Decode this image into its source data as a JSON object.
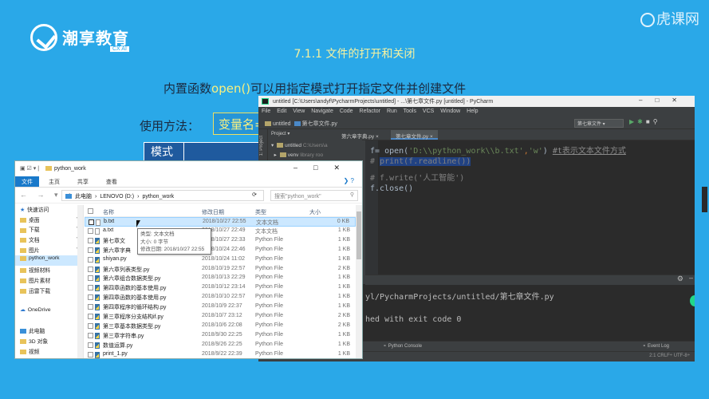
{
  "slide": {
    "logo_name": "潮享教育",
    "logo_sub": "CX AI",
    "watermark": "虎课网",
    "title": "7.1.1 文件的打开和关闭",
    "line_prefix": "内置函数",
    "line_highlight": "open()",
    "line_suffix": "可以用指定模式打开指定文件并创建文件",
    "usage_label": "使用方法：",
    "usage_box": "变量名=",
    "table_header": "模式"
  },
  "pycharm": {
    "title": "untitled [C:\\Users\\andyf\\PycharmProjects\\untitled] - ...\\第七章文件.py [untitled] - PyCharm",
    "menu": [
      "File",
      "Edit",
      "View",
      "Navigate",
      "Code",
      "Refactor",
      "Run",
      "Tools",
      "VCS",
      "Window",
      "Help"
    ],
    "breadcrumb_project": "untitled",
    "breadcrumb_file": "第七章文件.py",
    "run_config": "第七章文件",
    "project_header": "Project",
    "strip_label": "1: Project",
    "tabs": [
      "第六章字典.py",
      "第七章文件.py"
    ],
    "tree": {
      "root": "untitled",
      "root_path": "C:\\Users\\a",
      "venv": "venv",
      "venv_note": "library roo"
    },
    "code": {
      "l1_var": "f",
      "l1_eq": "= open(",
      "l1_str": "'D:\\\\python_work\\\\b.txt'",
      "l1_comma": ",",
      "l1_mode": "'w'",
      "l1_close": ")",
      "l1_comment": "#t表示文本文件方式",
      "l2_hash": "# ",
      "l2_sel": "print(f.readline())",
      "l3": "# f.write('人工智能')",
      "l4": "f.close()"
    },
    "run": {
      "l1": "yl/PycharmProjects/untitled/第七章文件.py",
      "l2": "hed with exit code 0"
    },
    "bottom_tabs": [
      "Python Console"
    ],
    "event_log": "Event Log",
    "status": "2:1  CRLF÷  UTF-8÷"
  },
  "explorer": {
    "title": "python_work",
    "ribbon": {
      "file": "文件",
      "home": "主页",
      "share": "共享",
      "view": "查看"
    },
    "address": [
      "此电脑",
      "LENOVO (D:)",
      "python_work"
    ],
    "search_placeholder": "搜索\"python_work\"",
    "nav_items": [
      {
        "label": "快速访问",
        "icon": "star"
      },
      {
        "label": "桌面",
        "icon": "folder",
        "pin": true
      },
      {
        "label": "下载",
        "icon": "folder",
        "pin": true
      },
      {
        "label": "文档",
        "icon": "folder",
        "pin": true
      },
      {
        "label": "图片",
        "icon": "folder",
        "pin": true
      },
      {
        "label": "python_work",
        "icon": "folder",
        "selected": true
      },
      {
        "label": "视频材料",
        "icon": "folder"
      },
      {
        "label": "图片素材",
        "icon": "folder"
      },
      {
        "label": "迅雷下载",
        "icon": "folder"
      },
      {
        "label": "",
        "icon": "none"
      },
      {
        "label": "OneDrive",
        "icon": "cloud"
      },
      {
        "label": "",
        "icon": "none"
      },
      {
        "label": "此电脑",
        "icon": "pc"
      },
      {
        "label": "3D 对象",
        "icon": "folder"
      },
      {
        "label": "视频",
        "icon": "folder"
      }
    ],
    "columns": {
      "name": "名称",
      "date": "修改日期",
      "type": "类型",
      "size": "大小"
    },
    "files": [
      {
        "name": "b.txt",
        "date": "2018/10/27 22:55",
        "type": "文本文档",
        "size": "0 KB",
        "selected": true,
        "kind": "txt"
      },
      {
        "name": "a.txt",
        "date": "2018/10/27 22:49",
        "type": "文本文档",
        "size": "1 KB",
        "kind": "txt"
      },
      {
        "name": "第七章文",
        "date": "2018/10/27 22:33",
        "type": "Python File",
        "size": "1 KB",
        "kind": "py"
      },
      {
        "name": "第六章字典",
        "date": "2018/10/24 22:46",
        "type": "Python File",
        "size": "1 KB",
        "kind": "py"
      },
      {
        "name": "shiyan.py",
        "date": "2018/10/24 11:02",
        "type": "Python File",
        "size": "1 KB",
        "kind": "py"
      },
      {
        "name": "第六章列表类型.py",
        "date": "2018/10/19 22:57",
        "type": "Python File",
        "size": "2 KB",
        "kind": "py"
      },
      {
        "name": "第六章组合数据类型.py",
        "date": "2018/10/13 22:29",
        "type": "Python File",
        "size": "1 KB",
        "kind": "py"
      },
      {
        "name": "第四章函数的基本使用.py",
        "date": "2018/10/12 23:14",
        "type": "Python File",
        "size": "1 KB",
        "kind": "py"
      },
      {
        "name": "第四章函数的基本使用.py",
        "date": "2018/10/10 22:57",
        "type": "Python File",
        "size": "1 KB",
        "kind": "py"
      },
      {
        "name": "第四章程序的循环结构.py",
        "date": "2018/10/9 22:37",
        "type": "Python File",
        "size": "1 KB",
        "kind": "py"
      },
      {
        "name": "第三章程序分支结构if.py",
        "date": "2018/10/7 23:12",
        "type": "Python File",
        "size": "2 KB",
        "kind": "py"
      },
      {
        "name": "第三章基本数据类型.py",
        "date": "2018/10/6 22:08",
        "type": "Python File",
        "size": "2 KB",
        "kind": "py"
      },
      {
        "name": "第三章字符串.py",
        "date": "2018/9/30 22:25",
        "type": "Python File",
        "size": "1 KB",
        "kind": "py"
      },
      {
        "name": "数值运算.py",
        "date": "2018/9/26 22:25",
        "type": "Python File",
        "size": "1 KB",
        "kind": "py"
      },
      {
        "name": "print_1.py",
        "date": "2018/9/22 22:39",
        "type": "Python File",
        "size": "1 KB",
        "kind": "py"
      }
    ],
    "tooltip": {
      "type": "类型: 文本文档",
      "size": "大小: 0 字节",
      "modified": "修改日期: 2018/10/27 22:55"
    }
  }
}
